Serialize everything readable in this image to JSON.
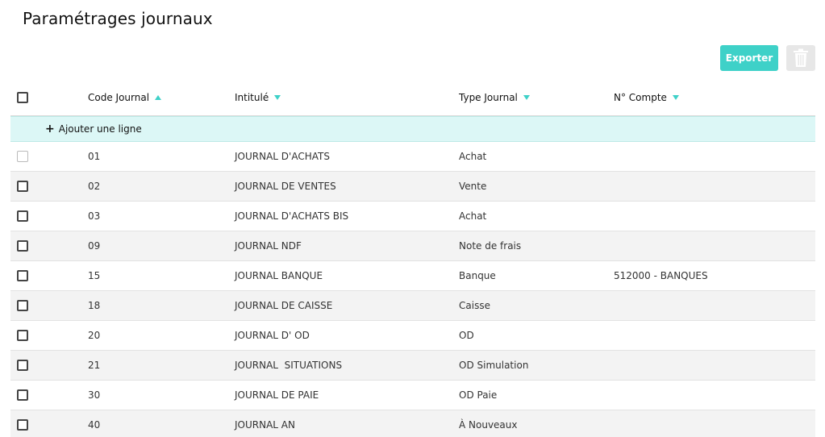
{
  "page": {
    "title": "Paramétrages journaux"
  },
  "toolbar": {
    "export_label": "Exporter"
  },
  "table": {
    "headers": {
      "code": "Code Journal",
      "intitule": "Intitulé",
      "type": "Type Journal",
      "compte": "N° Compte"
    },
    "sort": {
      "code": "ascending",
      "intitule": "descending",
      "type": "descending",
      "compte": "descending"
    },
    "add_row_label": "Ajouter une ligne",
    "rows": [
      {
        "code": "01",
        "intitule": "JOURNAL D'ACHATS",
        "type": "Achat",
        "compte": "",
        "checkbox_disabled": true
      },
      {
        "code": "02",
        "intitule": "JOURNAL DE VENTES",
        "type": "Vente",
        "compte": ""
      },
      {
        "code": "03",
        "intitule": "JOURNAL D'ACHATS BIS",
        "type": "Achat",
        "compte": ""
      },
      {
        "code": "09",
        "intitule": "JOURNAL NDF",
        "type": "Note de frais",
        "compte": ""
      },
      {
        "code": "15",
        "intitule": "JOURNAL BANQUE",
        "type": "Banque",
        "compte": "512000 - BANQUES"
      },
      {
        "code": "18",
        "intitule": "JOURNAL DE CAISSE",
        "type": "Caisse",
        "compte": ""
      },
      {
        "code": "20",
        "intitule": "JOURNAL D' OD",
        "type": "OD",
        "compte": ""
      },
      {
        "code": "21",
        "intitule": "JOURNAL  SITUATIONS",
        "type": "OD Simulation",
        "compte": ""
      },
      {
        "code": "30",
        "intitule": "JOURNAL DE PAIE",
        "type": "OD Paie",
        "compte": ""
      },
      {
        "code": "40",
        "intitule": "JOURNAL AN",
        "type": "À Nouveaux",
        "compte": ""
      }
    ]
  },
  "colors": {
    "accent": "#3ed1c8",
    "add_row_bg": "#dcf7f6",
    "alt_row_bg": "#f3f3f3",
    "delete_bg": "#e7e7e7"
  },
  "icons": {
    "sort_up": "triangle-up",
    "sort_down": "triangle-down",
    "delete": "trash-icon",
    "add": "plus-icon"
  }
}
